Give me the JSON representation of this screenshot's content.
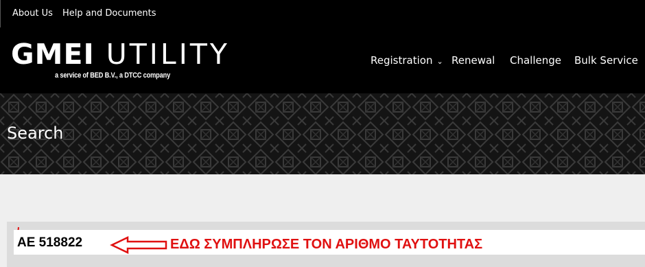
{
  "topbar": {
    "about": "About Us",
    "help": "Help and Documents"
  },
  "logo": {
    "bold": "GMEI",
    "thin": " UTILITY",
    "tagline": "a service of BED B.V., a DTCC company"
  },
  "nav": {
    "registration": "Registration",
    "renewal": "Renewal",
    "challenge": "Challenge",
    "bulk": "Bulk Service"
  },
  "page": {
    "title": "Search"
  },
  "search": {
    "value": "AE 518822"
  },
  "annotation": {
    "text": "ΕΔΩ ΣΥΜΠΛΗΡΩΣΕ ΤΟΝ ΑΡΙΘΜΟ ΤΑΥΤΟΤΗΤΑΣ",
    "color": "#e01010"
  },
  "colors": {
    "header_bg": "#000000",
    "page_bg": "#efefef",
    "search_bg": "#dcdcdc"
  }
}
